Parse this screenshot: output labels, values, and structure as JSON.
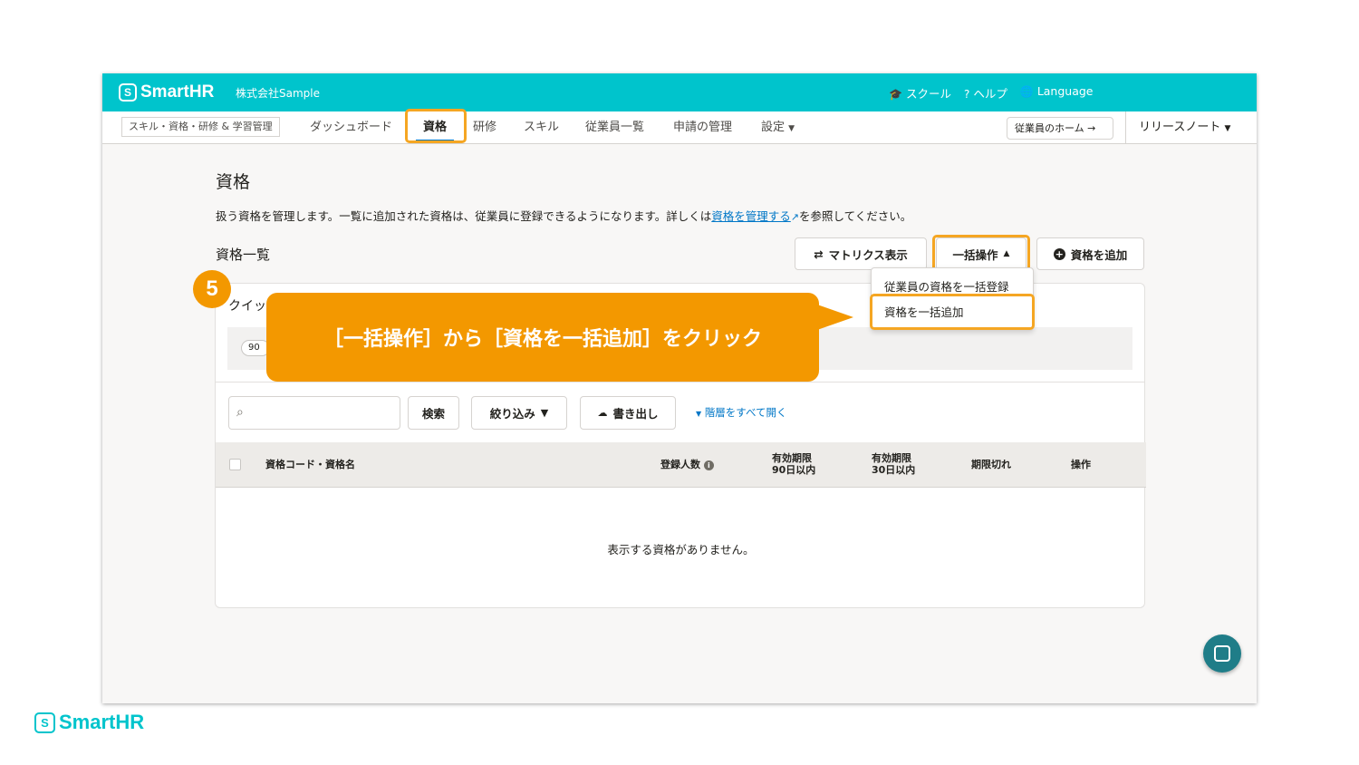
{
  "header": {
    "logo": "SmartHR",
    "tenant": "株式会社Sample",
    "links": [
      {
        "icon": "graduation-cap-icon",
        "glyph": "🎓",
        "label": "スクール"
      },
      {
        "icon": "help-icon",
        "glyph": "?",
        "label": "ヘルプ"
      },
      {
        "icon": "globe-icon",
        "glyph": "🌐",
        "label": "Language"
      }
    ]
  },
  "nav": {
    "app_label": "スキル・資格・研修 & 学習管理",
    "items": [
      "ダッシュボード",
      "資格",
      "研修",
      "スキル",
      "従業員一覧",
      "申請の管理",
      "設定"
    ],
    "home_button": "従業員のホーム →",
    "release_notes": "リリースノート"
  },
  "page": {
    "title": "資格",
    "description_before": "扱う資格を管理します。一覧に追加された資格は、従業員に登録できるようになります。詳しくは",
    "description_link": "資格を管理する",
    "description_after": "を参照してください。",
    "section_title": "資格一覧"
  },
  "toolbar": {
    "matrix_button": "マトリクス表示",
    "bulk_button": "一括操作",
    "add_button": "資格を追加"
  },
  "bulk_menu": {
    "items": [
      "従業員の資格を一括登録",
      "資格を一括追加"
    ]
  },
  "quick_filter": {
    "label": "クイッ",
    "chip": "90日"
  },
  "filters": {
    "search_placeholder": "",
    "search_button": "検索",
    "filter_button": "絞り込み",
    "export_button": "書き出し",
    "expand_link": "階層をすべて開く"
  },
  "table": {
    "columns": [
      "資格コード・資格名",
      "登録人数",
      "有効期限\n90日以内",
      "有効期限\n30日以内",
      "期限切れ",
      "操作"
    ],
    "empty_message": "表示する資格がありません。"
  },
  "annotation": {
    "step": "5",
    "text": "［一括操作］から［資格を一括追加］をクリック"
  },
  "footer": {
    "logo": "SmartHR"
  },
  "colors": {
    "brand": "#00c4cc",
    "highlight": "#f39800",
    "link": "#0077c7"
  }
}
